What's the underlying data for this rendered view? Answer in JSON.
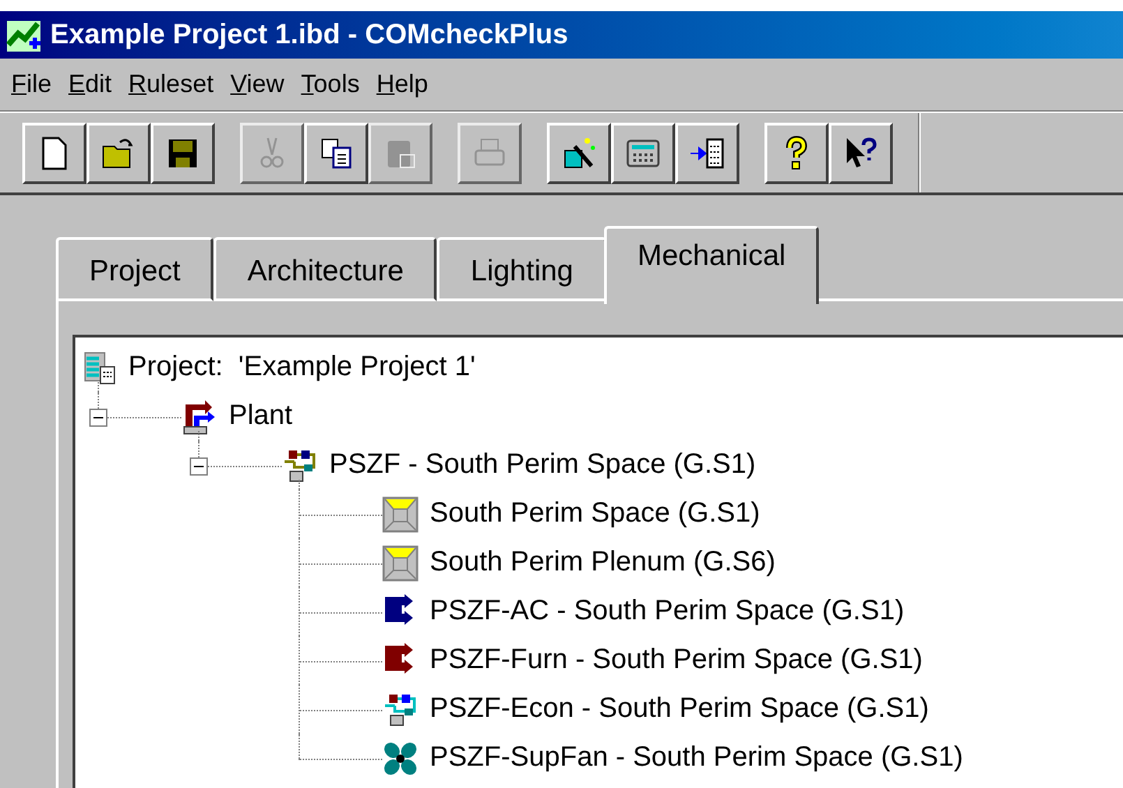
{
  "window": {
    "title": "Example Project 1.ibd - COMcheckPlus"
  },
  "menu": [
    {
      "label": "File"
    },
    {
      "label": "Edit"
    },
    {
      "label": "Ruleset"
    },
    {
      "label": "View"
    },
    {
      "label": "Tools"
    },
    {
      "label": "Help"
    }
  ],
  "toolbar": {
    "groups": [
      [
        {
          "kind": "new",
          "disabled": false
        },
        {
          "kind": "open",
          "disabled": false
        },
        {
          "kind": "save",
          "disabled": false
        }
      ],
      [
        {
          "kind": "cut",
          "disabled": true
        },
        {
          "kind": "copy",
          "disabled": false
        },
        {
          "kind": "paste",
          "disabled": true
        }
      ],
      [
        {
          "kind": "print",
          "disabled": true
        }
      ],
      [
        {
          "kind": "wizard",
          "disabled": false
        },
        {
          "kind": "calculator",
          "disabled": false
        },
        {
          "kind": "import",
          "disabled": false
        }
      ],
      [
        {
          "kind": "help",
          "disabled": false
        },
        {
          "kind": "context-help",
          "disabled": false
        }
      ]
    ]
  },
  "tabs": [
    {
      "label": "Project",
      "selected": false
    },
    {
      "label": "Architecture",
      "selected": false
    },
    {
      "label": "Lighting",
      "selected": false
    },
    {
      "label": "Mechanical",
      "selected": true
    }
  ],
  "tree": {
    "kind": "project",
    "label": "Project:  'Example Project 1'",
    "children": [
      {
        "kind": "plant",
        "label": "Plant",
        "expanded": true,
        "children": [
          {
            "kind": "system",
            "label": "PSZF - South Perim Space (G.S1)",
            "expanded": true,
            "children": [
              {
                "kind": "space",
                "label": "South Perim Space (G.S1)"
              },
              {
                "kind": "space",
                "label": "South Perim Plenum (G.S6)"
              },
              {
                "kind": "ac",
                "label": "PSZF-AC - South Perim Space (G.S1)"
              },
              {
                "kind": "furnace",
                "label": "PSZF-Furn - South Perim Space (G.S1)"
              },
              {
                "kind": "economizer",
                "label": "PSZF-Econ - South Perim Space (G.S1)"
              },
              {
                "kind": "fan",
                "label": "PSZF-SupFan - South Perim Space (G.S1)"
              }
            ]
          }
        ]
      }
    ]
  }
}
